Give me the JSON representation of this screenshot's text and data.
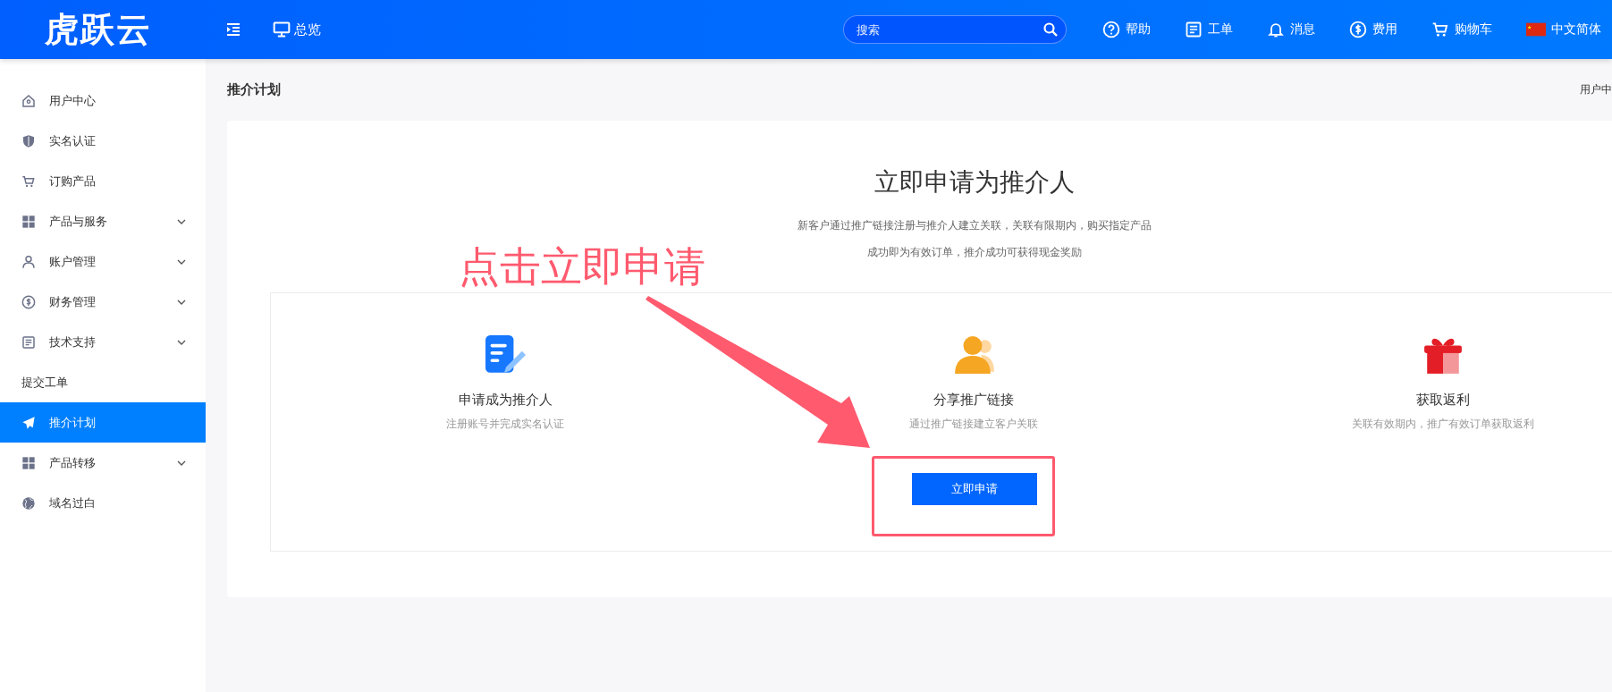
{
  "header": {
    "logo": "虎跃云",
    "nav": [
      {
        "label": "总览"
      }
    ],
    "search": {
      "placeholder": "搜索"
    },
    "links": [
      {
        "label": "帮助"
      },
      {
        "label": "工单"
      },
      {
        "label": "消息"
      },
      {
        "label": "费用"
      },
      {
        "label": "购物车"
      },
      {
        "label": "中文简体"
      }
    ]
  },
  "sidebar": {
    "items": [
      {
        "label": "用户中心",
        "kind": "link",
        "selected": false
      },
      {
        "label": "实名认证",
        "kind": "link",
        "selected": false
      },
      {
        "label": "订购产品",
        "kind": "link",
        "selected": false
      },
      {
        "label": "产品与服务",
        "kind": "group",
        "selected": false
      },
      {
        "label": "账户管理",
        "kind": "group",
        "selected": false
      },
      {
        "label": "财务管理",
        "kind": "group",
        "selected": false
      },
      {
        "label": "技术支持",
        "kind": "group",
        "selected": false
      },
      {
        "label": "提交工单",
        "kind": "sub",
        "selected": false
      },
      {
        "label": "推介计划",
        "kind": "link",
        "selected": true
      },
      {
        "label": "产品转移",
        "kind": "group",
        "selected": false
      },
      {
        "label": "域名过白",
        "kind": "link",
        "selected": false
      }
    ]
  },
  "page": {
    "title": "推介计划",
    "breadcrumb": "用户中"
  },
  "promo": {
    "title": "立即申请为推介人",
    "description": [
      "新客户通过推广链接注册与推介人建立关联，关联有限期内，购买指定产品",
      "成功即为有效订单，推介成功可获得现金奖励"
    ],
    "steps": [
      {
        "title": "申请成为推介人",
        "subtitle": "注册账号并完成实名认证"
      },
      {
        "title": "分享推广链接",
        "subtitle": "通过推广链接建立客户关联"
      },
      {
        "title": "获取返利",
        "subtitle": "关联有效期内，推广有效订单获取返利"
      }
    ],
    "button": "立即申请"
  },
  "annotation": {
    "text": "点击立即申请"
  }
}
